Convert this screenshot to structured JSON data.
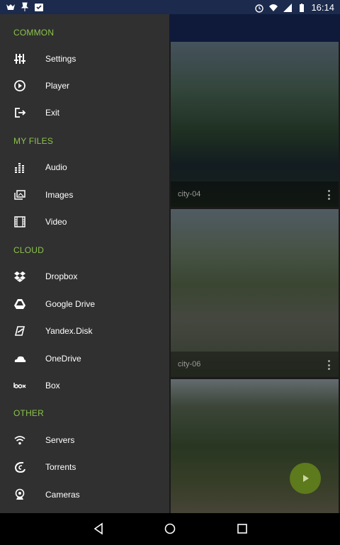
{
  "status_bar": {
    "time": "16:14"
  },
  "drawer": {
    "sections": [
      {
        "title": "COMMON",
        "items": [
          {
            "label": "Settings",
            "icon": "sliders-icon"
          },
          {
            "label": "Player",
            "icon": "play-circle-icon"
          },
          {
            "label": "Exit",
            "icon": "exit-icon"
          }
        ]
      },
      {
        "title": "MY FILES",
        "items": [
          {
            "label": "Audio",
            "icon": "equalizer-icon"
          },
          {
            "label": "Images",
            "icon": "images-icon"
          },
          {
            "label": "Video",
            "icon": "film-icon"
          }
        ]
      },
      {
        "title": "CLOUD",
        "items": [
          {
            "label": "Dropbox",
            "icon": "dropbox-icon"
          },
          {
            "label": "Google Drive",
            "icon": "google-drive-icon"
          },
          {
            "label": "Yandex.Disk",
            "icon": "yandex-disk-icon"
          },
          {
            "label": "OneDrive",
            "icon": "onedrive-icon"
          },
          {
            "label": "Box",
            "icon": "box-icon"
          }
        ]
      },
      {
        "title": "OTHER",
        "items": [
          {
            "label": "Servers",
            "icon": "wifi-icon"
          },
          {
            "label": "Torrents",
            "icon": "torrent-icon"
          },
          {
            "label": "Cameras",
            "icon": "webcam-icon"
          }
        ]
      }
    ]
  },
  "gallery": {
    "tiles": [
      {
        "title": "city-04"
      },
      {
        "title": "city-06"
      },
      {
        "title": ""
      }
    ]
  },
  "colors": {
    "accent": "#8bc34a",
    "drawer_bg": "#303030",
    "status_bar": "#1b2a4d"
  }
}
